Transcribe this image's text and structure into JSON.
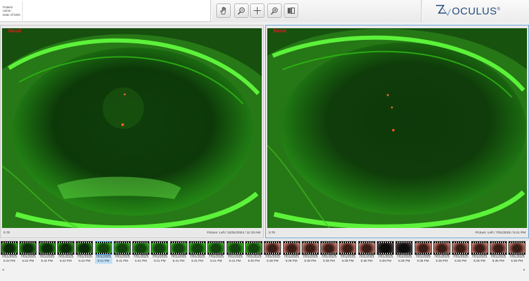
{
  "patient": {
    "name_label": "Patient name:",
    "dob_label": "Date of birth:"
  },
  "toolbar": {
    "tools": [
      {
        "name": "pan-hand-icon"
      },
      {
        "name": "zoom-out-icon"
      },
      {
        "name": "crosshair-icon"
      },
      {
        "name": "zoom-in-icon"
      },
      {
        "name": "compare-icon"
      }
    ]
  },
  "brand": {
    "logo_text": "OCULUS",
    "registered": "®"
  },
  "panels": {
    "left": {
      "nasal": "Nasal",
      "zoom": "0.70",
      "picture": "Picture: Left / 22/01/2024 / 11:33 AM"
    },
    "right": {
      "nasal": "Nasal",
      "zoom": "0.70",
      "picture": "Picture: Left / 7/01/2025 / 5:41 PM"
    }
  },
  "thumbnails": [
    {
      "date": "7/01/2025",
      "time": "5:42 PM",
      "tint": "green-dark"
    },
    {
      "date": "7/01/2025",
      "time": "5:42 PM",
      "tint": "green-dark"
    },
    {
      "date": "7/01/2025",
      "time": "5:42 PM",
      "tint": "green-dark"
    },
    {
      "date": "7/01/2025",
      "time": "5:42 PM",
      "tint": "green-dark"
    },
    {
      "date": "7/01/2025",
      "time": "5:42 PM",
      "tint": "green-dark"
    },
    {
      "date": "7/01/2025",
      "time": "5:41 PM",
      "tint": "green",
      "selected": true
    },
    {
      "date": "7/01/2025",
      "time": "5:41 PM",
      "tint": "green"
    },
    {
      "date": "7/01/2025",
      "time": "5:41 PM",
      "tint": "green"
    },
    {
      "date": "7/01/2025",
      "time": "5:41 PM",
      "tint": "green"
    },
    {
      "date": "7/01/2025",
      "time": "5:41 PM",
      "tint": "green"
    },
    {
      "date": "7/01/2025",
      "time": "5:41 PM",
      "tint": "green"
    },
    {
      "date": "7/01/2025",
      "time": "5:41 PM",
      "tint": "green"
    },
    {
      "date": "7/01/2025",
      "time": "5:41 PM",
      "tint": "green"
    },
    {
      "date": "7/01/2025",
      "time": "5:40 PM",
      "tint": "green"
    },
    {
      "date": "7/01/2025",
      "time": "5:38 PM",
      "tint": "pink"
    },
    {
      "date": "7/01/2025",
      "time": "5:38 PM",
      "tint": "pink"
    },
    {
      "date": "7/01/2025",
      "time": "5:38 PM",
      "tint": "pink"
    },
    {
      "date": "7/01/2025",
      "time": "5:38 PM",
      "tint": "pink"
    },
    {
      "date": "7/01/2025",
      "time": "5:38 PM",
      "tint": "pink"
    },
    {
      "date": "7/01/2025",
      "time": "5:38 PM",
      "tint": "pink"
    },
    {
      "date": "7/01/2025",
      "time": "5:38 PM",
      "tint": "dark"
    },
    {
      "date": "7/01/2025",
      "time": "5:36 PM",
      "tint": "dark"
    },
    {
      "date": "7/01/2025",
      "time": "5:36 PM",
      "tint": "pink"
    },
    {
      "date": "7/01/2025",
      "time": "5:36 PM",
      "tint": "pink"
    },
    {
      "date": "7/01/2025",
      "time": "5:36 PM",
      "tint": "pink"
    },
    {
      "date": "7/01/2025",
      "time": "5:36 PM",
      "tint": "pink"
    },
    {
      "date": "7/01/2025",
      "time": "5:36 PM",
      "tint": "pink"
    },
    {
      "date": "7/01/2025",
      "time": "5:36 PM",
      "tint": "pink"
    }
  ],
  "colors": {
    "fluorescein": "#39e61e",
    "selected_border": "#69a7d8",
    "nasal_label": "#e21c1c",
    "brand": "#244a7a"
  }
}
